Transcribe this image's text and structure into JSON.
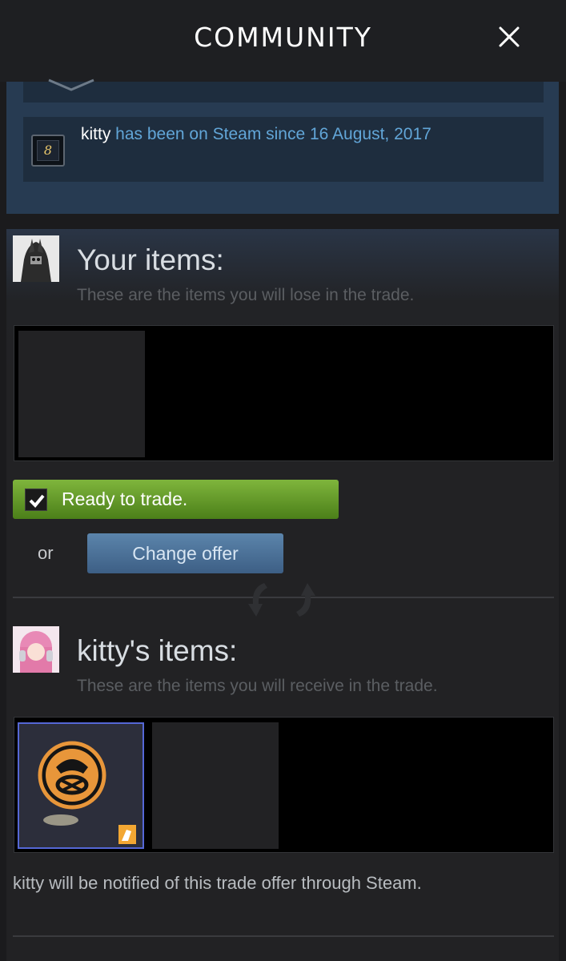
{
  "header": {
    "title": "COMMUNITY",
    "close_icon": "close-icon"
  },
  "profile": {
    "username": "kitty",
    "since_text": " has been on Steam since 16 August, 2017",
    "years_badge": "8"
  },
  "your_items": {
    "title": "Your items:",
    "subtitle": "These are the items you will lose in the trade."
  },
  "actions": {
    "ready_label": "Ready to trade.",
    "or_label": "or",
    "change_offer_label": "Change offer"
  },
  "their_items": {
    "title": "kitty's items:",
    "subtitle": "These are the items you will receive in the trade."
  },
  "footer": {
    "notify_text": "kitty will be notified of this trade offer through Steam."
  },
  "colors": {
    "accent_blue": "#62a6d8",
    "ready_green": "#7fb53c",
    "change_offer_blue": "#5b84ab",
    "selected_item_border": "#5567d6"
  }
}
